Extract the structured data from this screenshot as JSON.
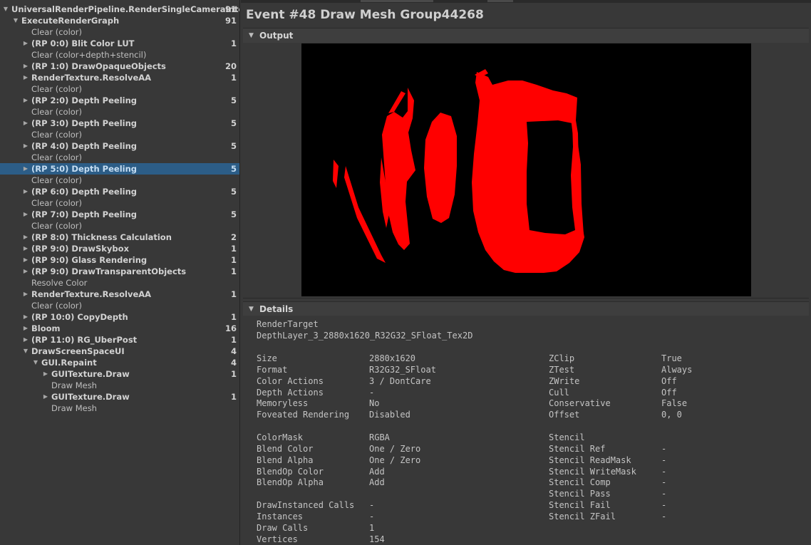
{
  "tree": [
    {
      "label": "UniversalRenderPipeline.RenderSingleCameraInter",
      "count": "91",
      "arrow": "down",
      "level": 0,
      "bold": true
    },
    {
      "label": "ExecuteRenderGraph",
      "count": "91",
      "arrow": "down",
      "level": 1,
      "bold": true
    },
    {
      "label": "Clear (color)",
      "count": "",
      "arrow": "",
      "level": 2,
      "bold": false
    },
    {
      "label": "(RP 0:0) Blit Color LUT",
      "count": "1",
      "arrow": "right",
      "level": 2,
      "bold": true
    },
    {
      "label": "Clear (color+depth+stencil)",
      "count": "",
      "arrow": "",
      "level": 2,
      "bold": false
    },
    {
      "label": "(RP 1:0) DrawOpaqueObjects",
      "count": "20",
      "arrow": "right",
      "level": 2,
      "bold": true
    },
    {
      "label": "RenderTexture.ResolveAA",
      "count": "1",
      "arrow": "right",
      "level": 2,
      "bold": true
    },
    {
      "label": "Clear (color)",
      "count": "",
      "arrow": "",
      "level": 2,
      "bold": false
    },
    {
      "label": "(RP 2:0) Depth Peeling",
      "count": "5",
      "arrow": "right",
      "level": 2,
      "bold": true
    },
    {
      "label": "Clear (color)",
      "count": "",
      "arrow": "",
      "level": 2,
      "bold": false
    },
    {
      "label": "(RP 3:0) Depth Peeling",
      "count": "5",
      "arrow": "right",
      "level": 2,
      "bold": true
    },
    {
      "label": "Clear (color)",
      "count": "",
      "arrow": "",
      "level": 2,
      "bold": false
    },
    {
      "label": "(RP 4:0) Depth Peeling",
      "count": "5",
      "arrow": "right",
      "level": 2,
      "bold": true
    },
    {
      "label": "Clear (color)",
      "count": "",
      "arrow": "",
      "level": 2,
      "bold": false
    },
    {
      "label": "(RP 5:0) Depth Peeling",
      "count": "5",
      "arrow": "right",
      "level": 2,
      "bold": true,
      "selected": true
    },
    {
      "label": "Clear (color)",
      "count": "",
      "arrow": "",
      "level": 2,
      "bold": false
    },
    {
      "label": "(RP 6:0) Depth Peeling",
      "count": "5",
      "arrow": "right",
      "level": 2,
      "bold": true
    },
    {
      "label": "Clear (color)",
      "count": "",
      "arrow": "",
      "level": 2,
      "bold": false
    },
    {
      "label": "(RP 7:0) Depth Peeling",
      "count": "5",
      "arrow": "right",
      "level": 2,
      "bold": true
    },
    {
      "label": "Clear (color)",
      "count": "",
      "arrow": "",
      "level": 2,
      "bold": false
    },
    {
      "label": "(RP 8:0) Thickness Calculation",
      "count": "2",
      "arrow": "right",
      "level": 2,
      "bold": true
    },
    {
      "label": "(RP 9:0) DrawSkybox",
      "count": "1",
      "arrow": "right",
      "level": 2,
      "bold": true
    },
    {
      "label": "(RP 9:0) Glass Rendering",
      "count": "1",
      "arrow": "right",
      "level": 2,
      "bold": true
    },
    {
      "label": "(RP 9:0) DrawTransparentObjects",
      "count": "1",
      "arrow": "right",
      "level": 2,
      "bold": true
    },
    {
      "label": "Resolve Color",
      "count": "",
      "arrow": "",
      "level": 2,
      "bold": false
    },
    {
      "label": "RenderTexture.ResolveAA",
      "count": "1",
      "arrow": "right",
      "level": 2,
      "bold": true
    },
    {
      "label": "Clear (color)",
      "count": "",
      "arrow": "",
      "level": 2,
      "bold": false
    },
    {
      "label": "(RP 10:0) CopyDepth",
      "count": "1",
      "arrow": "right",
      "level": 2,
      "bold": true
    },
    {
      "label": "Bloom",
      "count": "16",
      "arrow": "right",
      "level": 2,
      "bold": true
    },
    {
      "label": "(RP 11:0) RG_UberPost",
      "count": "1",
      "arrow": "right",
      "level": 2,
      "bold": true
    },
    {
      "label": "DrawScreenSpaceUI",
      "count": "4",
      "arrow": "down",
      "level": 2,
      "bold": true
    },
    {
      "label": "GUI.Repaint",
      "count": "4",
      "arrow": "down",
      "level": 3,
      "bold": true
    },
    {
      "label": "GUITexture.Draw",
      "count": "1",
      "arrow": "right",
      "level": 4,
      "bold": true
    },
    {
      "label": "Draw Mesh",
      "count": "",
      "arrow": "",
      "level": 4,
      "bold": false
    },
    {
      "label": "GUITexture.Draw",
      "count": "1",
      "arrow": "right",
      "level": 4,
      "bold": true
    },
    {
      "label": "Draw Mesh",
      "count": "",
      "arrow": "",
      "level": 4,
      "bold": false
    }
  ],
  "event_title": "Event #48 Draw Mesh Group44268",
  "output_label": "Output",
  "details_label": "Details",
  "render_target_label": "RenderTarget",
  "render_target_value": "DepthLayer_3_2880x1620_R32G32_SFloat_Tex2D",
  "left_props": [
    {
      "k": "Size",
      "v": "2880x1620"
    },
    {
      "k": "Format",
      "v": "R32G32_SFloat"
    },
    {
      "k": "Color Actions",
      "v": "3 / DontCare"
    },
    {
      "k": "Depth Actions",
      "v": "-"
    },
    {
      "k": "Memoryless",
      "v": "No"
    },
    {
      "k": "Foveated Rendering",
      "v": "Disabled"
    },
    {
      "k": "",
      "v": ""
    },
    {
      "k": "ColorMask",
      "v": "RGBA"
    },
    {
      "k": "Blend Color",
      "v": "One / Zero"
    },
    {
      "k": "Blend Alpha",
      "v": "One / Zero"
    },
    {
      "k": "BlendOp Color",
      "v": "Add"
    },
    {
      "k": "BlendOp Alpha",
      "v": "Add"
    },
    {
      "k": "",
      "v": ""
    },
    {
      "k": "DrawInstanced Calls",
      "v": "-"
    },
    {
      "k": "Instances",
      "v": "-"
    },
    {
      "k": "Draw Calls",
      "v": "1"
    },
    {
      "k": "Vertices",
      "v": "154"
    }
  ],
  "right_props": [
    {
      "k": "ZClip",
      "v": "True"
    },
    {
      "k": "ZTest",
      "v": "Always"
    },
    {
      "k": "ZWrite",
      "v": "Off"
    },
    {
      "k": "Cull",
      "v": "Off"
    },
    {
      "k": "Conservative",
      "v": "False"
    },
    {
      "k": "Offset",
      "v": "0, 0"
    },
    {
      "k": "",
      "v": ""
    },
    {
      "k": "Stencil",
      "v": ""
    },
    {
      "k": "Stencil Ref",
      "v": "-"
    },
    {
      "k": "Stencil ReadMask",
      "v": "-"
    },
    {
      "k": "Stencil WriteMask",
      "v": "-"
    },
    {
      "k": "Stencil Comp",
      "v": "-"
    },
    {
      "k": "Stencil Pass",
      "v": "-"
    },
    {
      "k": "Stencil Fail",
      "v": "-"
    },
    {
      "k": "Stencil ZFail",
      "v": "-"
    }
  ],
  "colors": {
    "selected_row": "#2c5d87",
    "mask_fill": "#ff0000",
    "viewport_bg": "#000000"
  }
}
